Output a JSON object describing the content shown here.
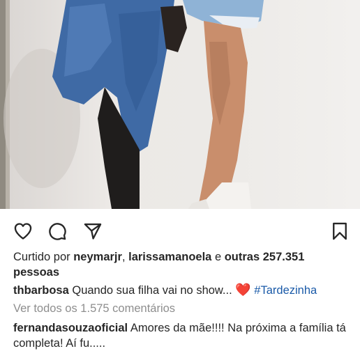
{
  "post": {
    "photo_alt": "photo",
    "actions": {
      "like_icon": "heart-outline",
      "comment_icon": "speech-bubble",
      "share_icon": "paper-plane",
      "save_icon": "bookmark"
    },
    "likes": {
      "prefix": "Curtido por ",
      "user1": "neymarjr",
      "sep": ", ",
      "user2": "larissamanoela",
      "conj": " e ",
      "others": "outras 257.351",
      "suffix": "pessoas"
    },
    "caption": {
      "user": "thbarbosa",
      "text": "Quando sua filha vai no show...",
      "emoji": "❤️",
      "hashtag": "#Tardezinha"
    },
    "view_all_comments": "Ver todos os 1.575 comentários",
    "comment": {
      "user": "fernandasouzaoficial",
      "text": "Amores da mãe!!!! Na próxima a família tá completa! Aí fu....."
    },
    "colors": {
      "text": "#262626",
      "muted": "#8e8e8e",
      "hashtag": "#1a5aa8",
      "heart": "#e0242c"
    }
  }
}
